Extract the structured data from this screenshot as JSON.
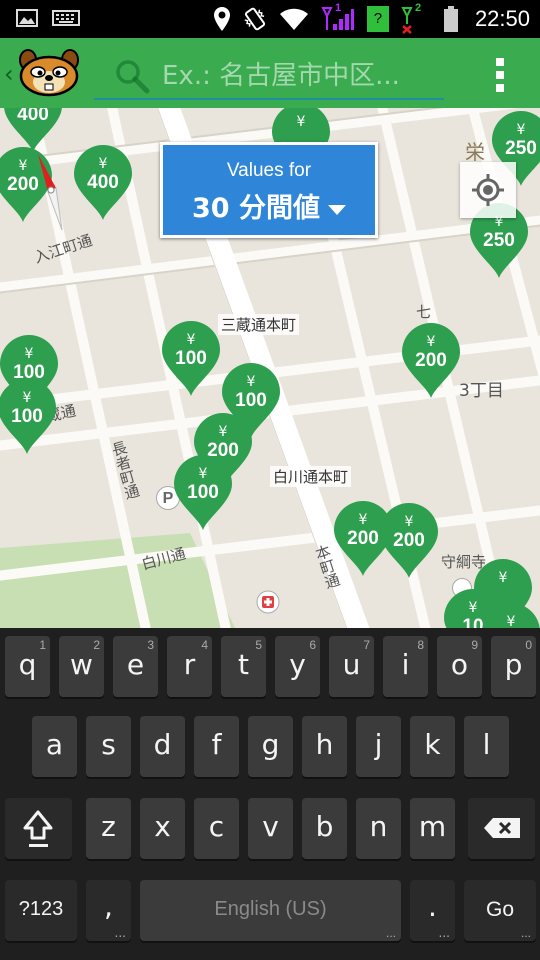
{
  "status_bar": {
    "time": "22:50",
    "icons": [
      "gallery-icon",
      "keyboard-icon",
      "location-icon",
      "vibrate-icon",
      "wifi-icon",
      "signal-1-icon",
      "sim-unknown-icon",
      "signal-2-no-service-icon",
      "battery-icon"
    ],
    "sim1_label": "1",
    "sim2_label": "2",
    "sim_unknown": "?"
  },
  "action_bar": {
    "back_glyph": "‹",
    "logo": "squirrel-logo",
    "search_placeholder": "Ex.: 名古屋市中区...",
    "menu_icon": "overflow-menu-icon",
    "colors": {
      "bar": "#3aab4e",
      "accent": "#1d8fa0"
    }
  },
  "values_selector": {
    "caption": "Values for",
    "value": "30 分間値",
    "color": "#2f86d8"
  },
  "map": {
    "labels": {
      "irie": "入江町通",
      "mikura": "三蔵通本町",
      "mikura_dori": "三蔵通",
      "nagaja": "長者町通",
      "shirakawa_hon": "白川通本町",
      "shirakawa": "白川通",
      "honmachi": "本町通",
      "sanchome": "3丁目",
      "moritsunadera": "守綱寺",
      "sakae": "栄",
      "shichi": "七",
      "parking": "P"
    },
    "pin_color": "#2e9e4f",
    "yen": "¥",
    "pins": [
      {
        "value": "400"
      },
      {
        "value": "200"
      },
      {
        "value": "400"
      },
      {
        "value": ""
      },
      {
        "value": "250"
      },
      {
        "value": "250"
      },
      {
        "value": "100"
      },
      {
        "value": "100"
      },
      {
        "value": "100"
      },
      {
        "value": "100"
      },
      {
        "value": "200"
      },
      {
        "value": "100"
      },
      {
        "value": "200"
      },
      {
        "value": "200"
      },
      {
        "value": "200"
      },
      {
        "value": "10"
      },
      {
        "value": ""
      },
      {
        "value": ""
      }
    ]
  },
  "keyboard": {
    "row1": [
      {
        "label": "q",
        "hint": "1"
      },
      {
        "label": "w",
        "hint": "2"
      },
      {
        "label": "e",
        "hint": "3"
      },
      {
        "label": "r",
        "hint": "4"
      },
      {
        "label": "t",
        "hint": "5"
      },
      {
        "label": "y",
        "hint": "6"
      },
      {
        "label": "u",
        "hint": "7"
      },
      {
        "label": "i",
        "hint": "8"
      },
      {
        "label": "o",
        "hint": "9"
      },
      {
        "label": "p",
        "hint": "0"
      }
    ],
    "row2": [
      "a",
      "s",
      "d",
      "f",
      "g",
      "h",
      "j",
      "k",
      "l"
    ],
    "row3": [
      "z",
      "x",
      "c",
      "v",
      "b",
      "n",
      "m"
    ],
    "symbols_label": "?123",
    "comma_label": ",",
    "space_label": "English (US)",
    "period_label": ".",
    "go_label": "Go",
    "dots": "..."
  }
}
